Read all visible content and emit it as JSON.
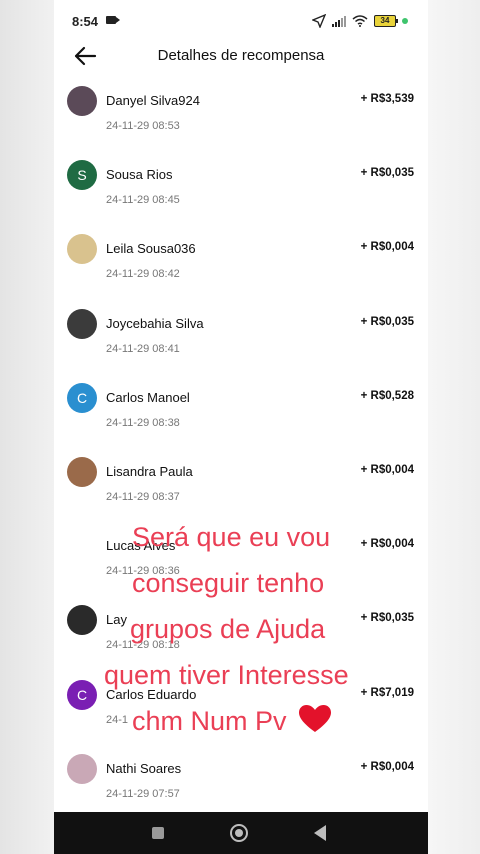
{
  "status_bar": {
    "time": "8:54",
    "battery": "34"
  },
  "header": {
    "title": "Detalhes de recompensa"
  },
  "items": [
    {
      "name": "Danyel Silva924",
      "time": "24-11-29 08:53",
      "amount": "+ R$3,539",
      "avatar_letter": "",
      "avatar_color": "#5b4a58"
    },
    {
      "name": "Sousa Rios",
      "time": "24-11-29 08:45",
      "amount": "+ R$0,035",
      "avatar_letter": "S",
      "avatar_color": "#1f6b43"
    },
    {
      "name": "Leila Sousa036",
      "time": "24-11-29 08:42",
      "amount": "+ R$0,004",
      "avatar_letter": "",
      "avatar_color": "#d9c28e"
    },
    {
      "name": "Joycebahia Silva",
      "time": "24-11-29 08:41",
      "amount": "+ R$0,035",
      "avatar_letter": "",
      "avatar_color": "#3b3b3b"
    },
    {
      "name": "Carlos Manoel",
      "time": "24-11-29 08:38",
      "amount": "+ R$0,528",
      "avatar_letter": "C",
      "avatar_color": "#2a8fd0"
    },
    {
      "name": "Lisandra Paula",
      "time": "24-11-29 08:37",
      "amount": "+ R$0,004",
      "avatar_letter": "",
      "avatar_color": "#9a6a4a"
    },
    {
      "name": "Lucas Alves",
      "time": "24-11-29 08:36",
      "amount": "+ R$0,004",
      "avatar_letter": "",
      "avatar_color": "#ffffff"
    },
    {
      "name": "Lay",
      "time": "24-11-29 08:18",
      "amount": "+ R$0,035",
      "avatar_letter": "",
      "avatar_color": "#2a2a2a"
    },
    {
      "name": "Carlos Eduardo",
      "time": "24-1",
      "amount": "+ R$7,019",
      "avatar_letter": "C",
      "avatar_color": "#7a1fb3"
    },
    {
      "name": "Nathi Soares",
      "time": "24-11-29 07:57",
      "amount": "+ R$0,004",
      "avatar_letter": "",
      "avatar_color": "#c9a8b6"
    }
  ],
  "overlay_text": [
    "Será que eu vou",
    "conseguir tenho",
    "grupos de Ajuda",
    "quem tiver Interesse",
    "chm Num Pv"
  ],
  "colors": {
    "overlay": "#ea3f55",
    "nav_bar": "#111111"
  }
}
